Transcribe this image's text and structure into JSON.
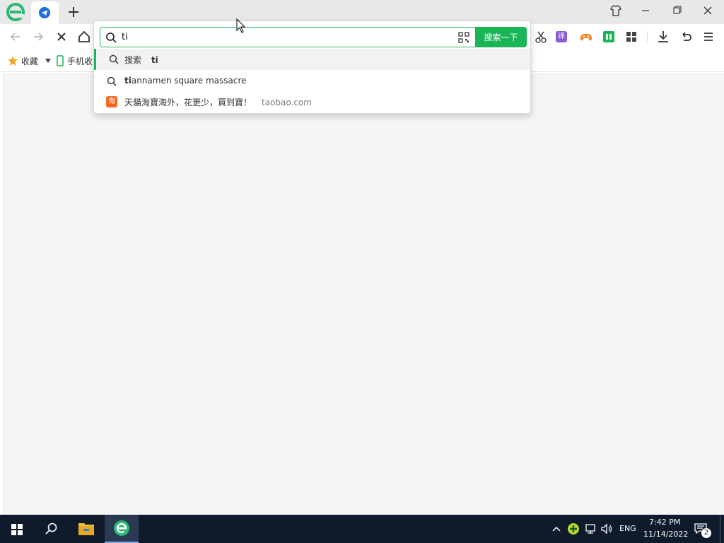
{
  "browser": {
    "tab": {
      "icon": "telegram-icon"
    },
    "window_controls": [
      "shirt-icon",
      "minimize-icon",
      "restore-icon",
      "close-icon"
    ]
  },
  "toolbar": {
    "left_icons": [
      "back-icon",
      "forward-icon",
      "stop-icon",
      "home-icon"
    ],
    "right_icons": [
      "scissors-icon",
      "translate-icon",
      "game-icon",
      "book-icon",
      "apps-icon",
      "download-icon",
      "undo-icon",
      "menu-icon"
    ],
    "translate_label": "译"
  },
  "bookmarks": {
    "favorites_label": "收藏",
    "mobile_label": "手机收"
  },
  "search": {
    "query": "ti",
    "submit_label": "搜索一下",
    "suggestions": [
      {
        "prefix": "搜索",
        "term": "ti",
        "icon": "search-icon"
      },
      {
        "bold": "ti",
        "rest": "annamen square massacre",
        "icon": "search-icon"
      },
      {
        "title": "天貓淘寶海外，花更少，買到寶！",
        "url": "taobao.com",
        "icon": "taobao-icon",
        "icon_text": "淘"
      }
    ]
  },
  "taskbar": {
    "lang": "ENG",
    "time": "7:42 PM",
    "date": "11/14/2022",
    "notification_count": "2"
  },
  "colors": {
    "accent": "#19b556",
    "taskbar": "#0f1b2b"
  }
}
